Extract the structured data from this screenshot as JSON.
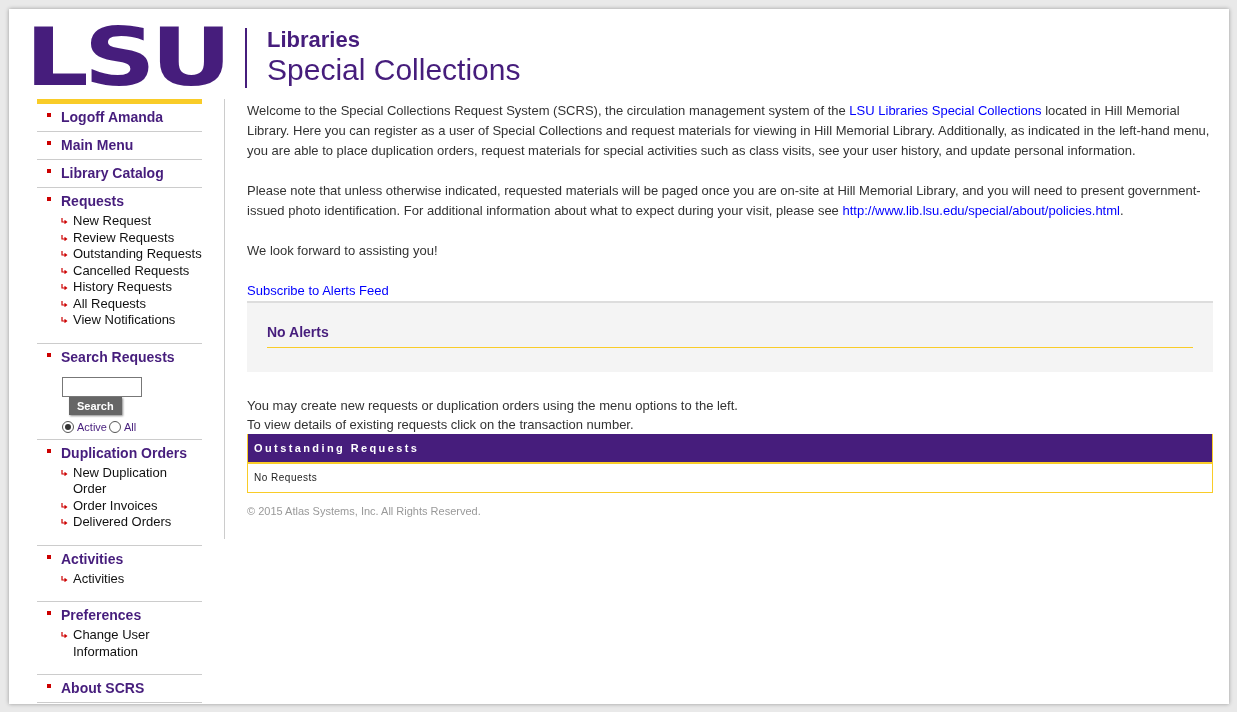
{
  "header": {
    "logo": "LSU",
    "line1": "Libraries",
    "line2": "Special Collections"
  },
  "sidebar": {
    "sections": [
      {
        "kind": "link",
        "title": "Logoff Amanda"
      },
      {
        "kind": "link",
        "title": "Main Menu"
      },
      {
        "kind": "link",
        "title": "Library Catalog"
      },
      {
        "kind": "group",
        "title": "Requests",
        "items": [
          "New Request",
          "Review Requests",
          "Outstanding Requests",
          "Cancelled Requests",
          "History Requests",
          "All Requests",
          "View Notifications"
        ]
      },
      {
        "kind": "search",
        "title": "Search Requests",
        "button": "Search",
        "options": [
          {
            "label": "Active",
            "selected": true
          },
          {
            "label": "All",
            "selected": false
          }
        ]
      },
      {
        "kind": "group",
        "title": "Duplication Orders",
        "items": [
          "New Duplication Order",
          "Order Invoices",
          "Delivered Orders"
        ]
      },
      {
        "kind": "group",
        "title": "Activities",
        "items": [
          "Activities"
        ]
      },
      {
        "kind": "group",
        "title": "Preferences",
        "items": [
          "Change User Information"
        ]
      },
      {
        "kind": "link",
        "title": "About SCRS"
      }
    ]
  },
  "main": {
    "paragraphs": [
      {
        "before": "Welcome to the Special Collections Request System (SCRS), the circulation management system of the ",
        "link": "LSU Libraries Special Collections",
        "after": " located in Hill Memorial Library. Here you can register as a user of Special Collections and request materials for viewing in Hill Memorial Library. Additionally, as indicated in the left-hand menu, you are able to place duplication orders, request materials for special activities such as class visits, see your user history, and update personal information."
      },
      {
        "before": "Please note that unless otherwise indicated, requested materials will be paged once you are on-site at Hill Memorial Library, and you will need to present government-issued photo identification. For additional information about what to expect during your visit, please see ",
        "link": "http://www.lib.lsu.edu/special/about/policies.html",
        "after": "."
      },
      {
        "before": "We look forward to assisting you!"
      }
    ],
    "alerts_link": "Subscribe to Alerts Feed",
    "alerts_title": "No Alerts",
    "info_lines": [
      "You may create new requests or duplication orders using the menu options to the left.",
      "To view details of existing requests click on the transaction number."
    ],
    "table": {
      "title": "Outstanding Requests",
      "empty": "No Requests"
    },
    "footer": "© 2015 Atlas Systems, Inc. All Rights Reserved."
  }
}
